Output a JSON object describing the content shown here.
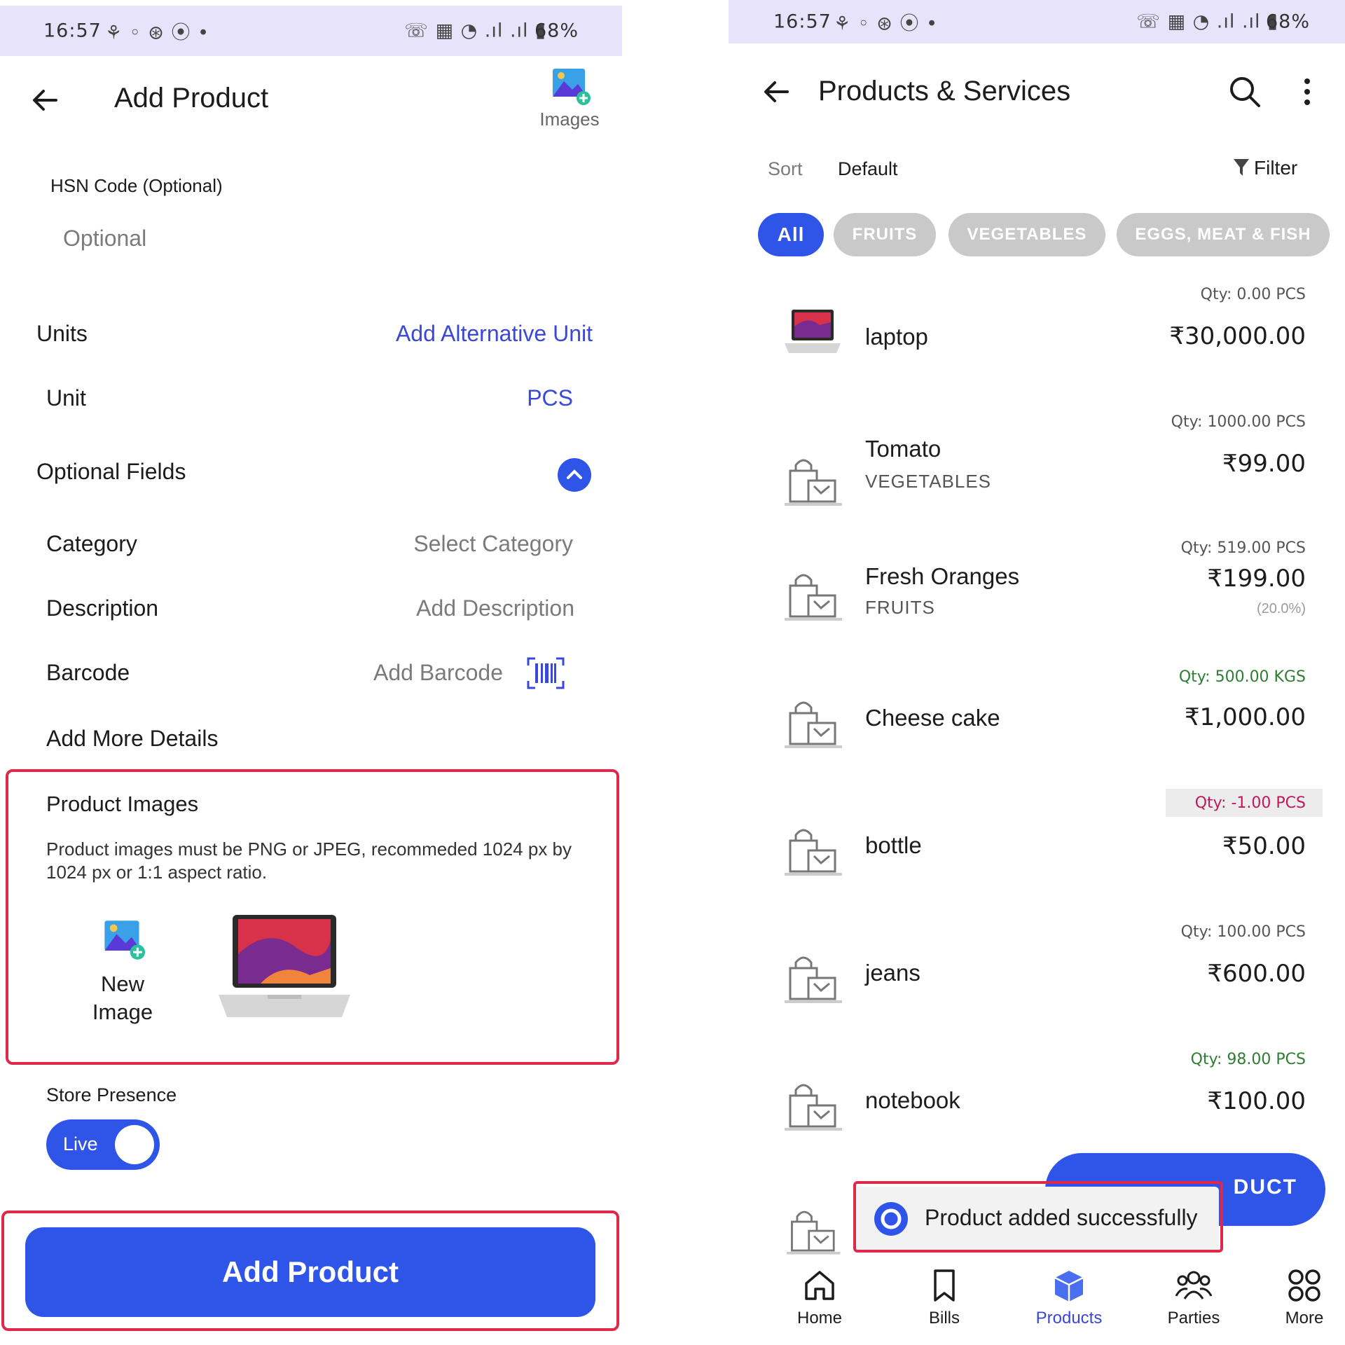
{
  "left": {
    "status": {
      "time": "16:57",
      "battery": "68%"
    },
    "header": {
      "title": "Add Product",
      "images_label": "Images"
    },
    "hsn": {
      "label": "HSN Code (Optional)",
      "placeholder": "Optional"
    },
    "units": {
      "label": "Units",
      "add_alt": "Add Alternative Unit",
      "unit_label": "Unit",
      "unit_value": "PCS"
    },
    "optional_fields": {
      "label": "Optional Fields",
      "category_label": "Category",
      "category_value": "Select Category",
      "description_label": "Description",
      "description_value": "Add Description",
      "barcode_label": "Barcode",
      "barcode_value": "Add Barcode",
      "more_details": "Add More Details"
    },
    "product_images": {
      "title": "Product Images",
      "hint": "Product images must be PNG or JPEG, recommeded 1024 px by 1024 px or 1:1 aspect ratio.",
      "new_image": "New Image"
    },
    "store_presence": {
      "label": "Store Presence",
      "toggle_label": "Live",
      "enabled": true
    },
    "submit_label": "Add Product"
  },
  "right": {
    "status": {
      "time": "16:57",
      "battery": "68%"
    },
    "header": {
      "title": "Products & Services"
    },
    "sort": {
      "label": "Sort",
      "value": "Default",
      "filter": "Filter"
    },
    "chips": [
      "All",
      "FRUITS",
      "VEGETABLES",
      "EGGS, MEAT & FISH"
    ],
    "products": [
      {
        "name": "laptop",
        "category": "",
        "qty": "Qty: 0.00 PCS",
        "price": "₹30,000.00",
        "discount": ""
      },
      {
        "name": "Tomato",
        "category": "VEGETABLES",
        "qty": "Qty: 1000.00 PCS",
        "price": "₹99.00",
        "discount": ""
      },
      {
        "name": "Fresh Oranges",
        "category": "FRUITS",
        "qty": "Qty: 519.00 PCS",
        "price": "₹199.00",
        "discount": "(20.0%)"
      },
      {
        "name": "Cheese cake",
        "category": "",
        "qty": "Qty: 500.00 KGS",
        "price": "₹1,000.00",
        "discount": ""
      },
      {
        "name": "bottle",
        "category": "",
        "qty": "Qty: -1.00 PCS",
        "price": "₹50.00",
        "discount": ""
      },
      {
        "name": "jeans",
        "category": "",
        "qty": "Qty: 100.00 PCS",
        "price": "₹600.00",
        "discount": ""
      },
      {
        "name": "notebook",
        "category": "",
        "qty": "Qty: 98.00 PCS",
        "price": "₹100.00",
        "discount": ""
      }
    ],
    "fab_label": "DUCT",
    "toast": "Product added successfully",
    "nav": [
      "Home",
      "Bills",
      "Products",
      "Parties",
      "More"
    ],
    "colors": {
      "accent": "#2f55e8",
      "negative_qty": "#c2185b",
      "positive_qty": "#2e7d32",
      "highlight": "#e0294a"
    }
  }
}
